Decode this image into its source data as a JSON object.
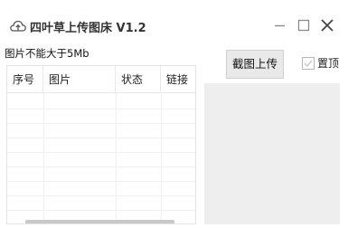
{
  "window": {
    "title": "四叶草上传图床 V1.2",
    "icon": "cloud-upload-icon"
  },
  "window_controls": {
    "minimize": "minimize-icon",
    "maximize": "maximize-icon",
    "close": "close-icon"
  },
  "size_note": "图片不能大于5Mb",
  "table": {
    "columns": [
      "序号",
      "图片",
      "状态",
      "链接"
    ],
    "rows": []
  },
  "capture_button": {
    "label": "截图上传"
  },
  "ontop": {
    "label": "置顶",
    "checked": false
  }
}
